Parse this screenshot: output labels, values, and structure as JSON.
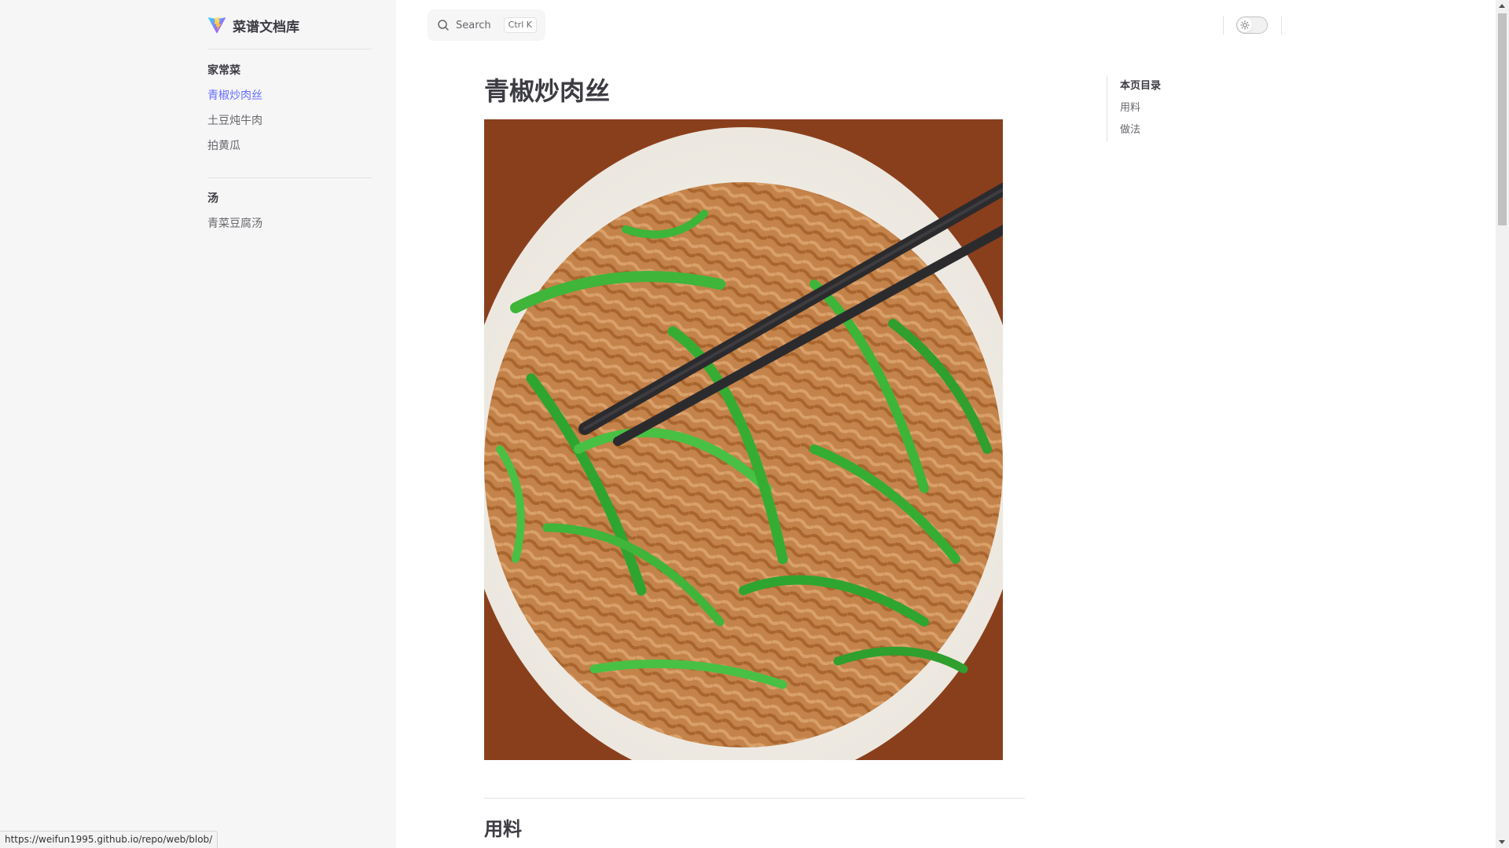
{
  "brand": {
    "title": "菜谱文档库"
  },
  "sidebar": {
    "groups": [
      {
        "title": "家常菜",
        "items": [
          {
            "label": "青椒炒肉丝",
            "active": true
          },
          {
            "label": "土豆炖牛肉",
            "active": false
          },
          {
            "label": "拍黄瓜",
            "active": false
          }
        ]
      },
      {
        "title": "汤",
        "items": [
          {
            "label": "青菜豆腐汤",
            "active": false
          }
        ]
      }
    ]
  },
  "search": {
    "placeholder": "Search",
    "shortcut": "Ctrl K"
  },
  "main": {
    "title": "青椒炒肉丝",
    "section_heading": "用料"
  },
  "outline": {
    "title": "本页目录",
    "links": [
      "用料",
      "做法"
    ]
  },
  "status_url": "https://weifun1995.github.io/repo/web/blob/",
  "colors": {
    "accent": "#646cff",
    "sidebar_bg": "#f6f6f7",
    "text": "#3c3c43",
    "muted": "#67676c"
  },
  "icons": {
    "logo": "vite-logo-icon",
    "search": "search-icon",
    "theme": "sun-icon"
  }
}
